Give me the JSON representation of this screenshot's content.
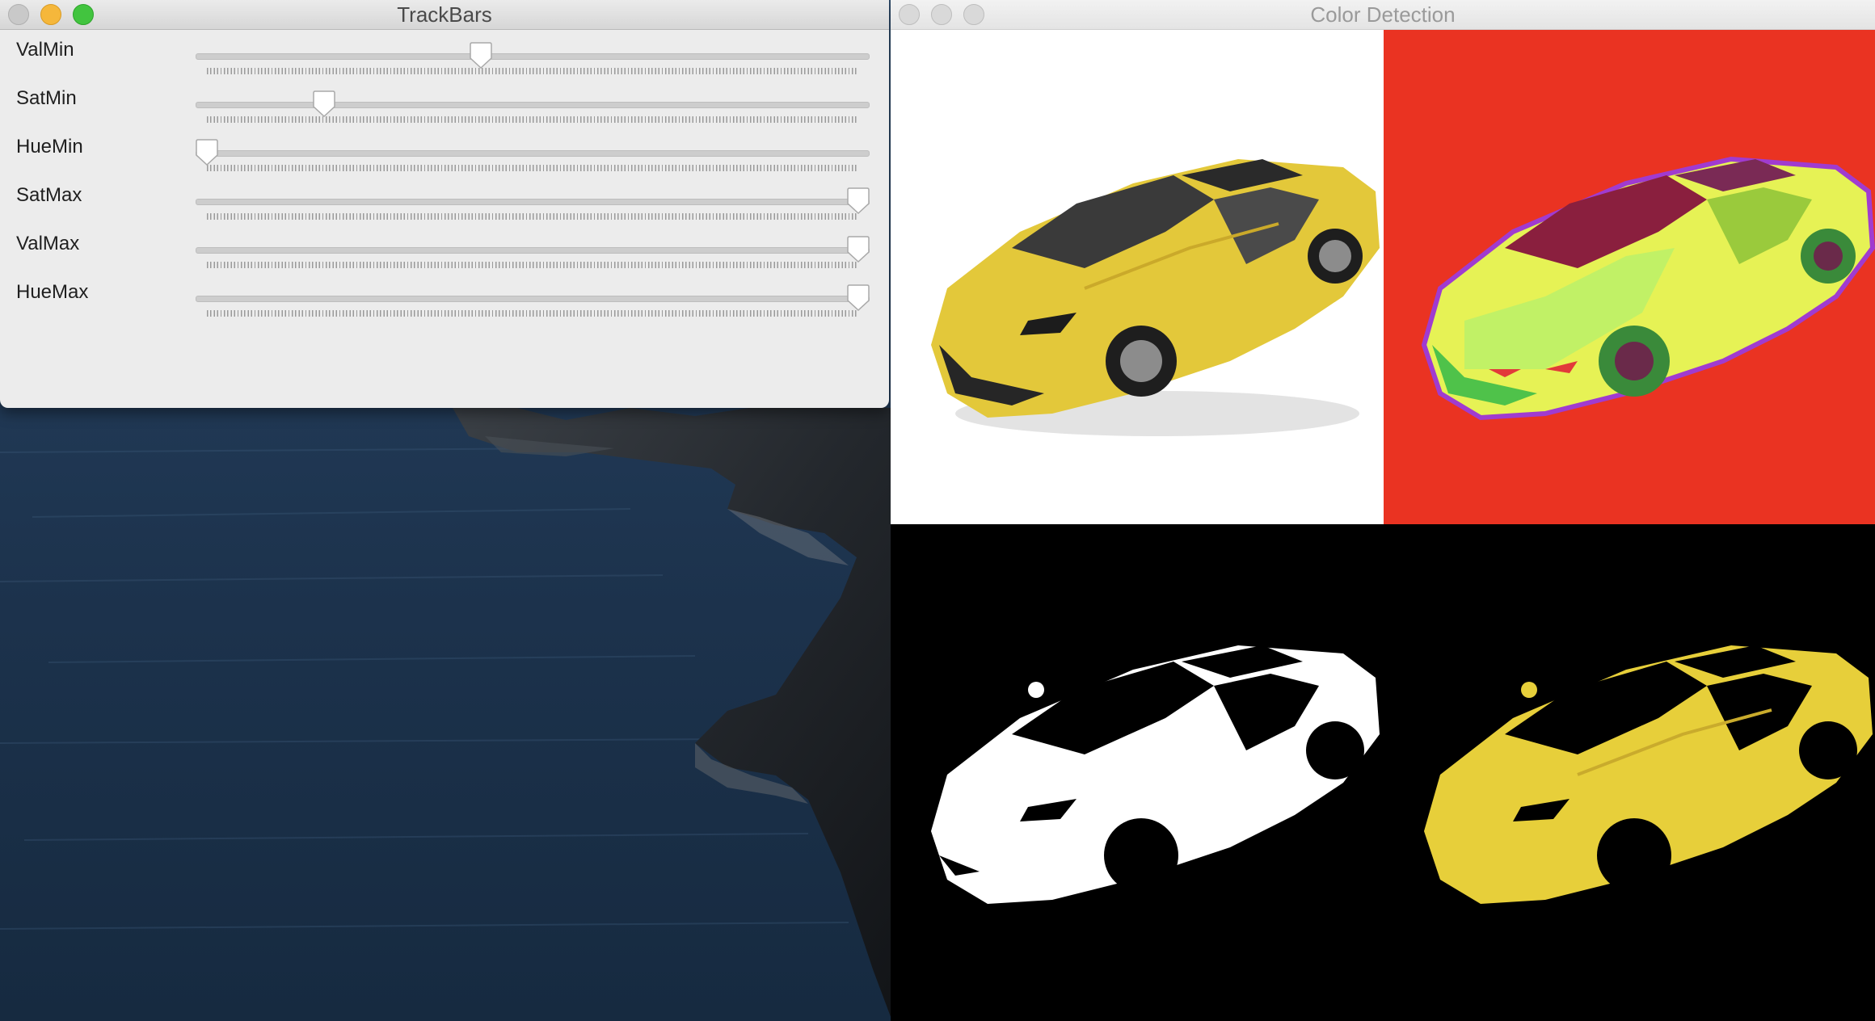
{
  "trackbars_window": {
    "title": "TrackBars",
    "sliders": [
      {
        "label": "ValMin",
        "fraction": 0.42
      },
      {
        "label": "SatMin",
        "fraction": 0.18
      },
      {
        "label": "HueMin",
        "fraction": 0.0
      },
      {
        "label": "SatMax",
        "fraction": 1.0
      },
      {
        "label": "ValMax",
        "fraction": 1.0
      },
      {
        "label": "HueMax",
        "fraction": 1.0
      }
    ]
  },
  "detect_window": {
    "title": "Color Detection",
    "panes": [
      "original",
      "hsv",
      "mask",
      "result"
    ]
  },
  "colors": {
    "car_yellow": "#e7cf3a",
    "hsv_background": "#ea3322",
    "hsv_car": "#e6f255",
    "mask_white": "#ffffff",
    "mask_black": "#000000"
  }
}
